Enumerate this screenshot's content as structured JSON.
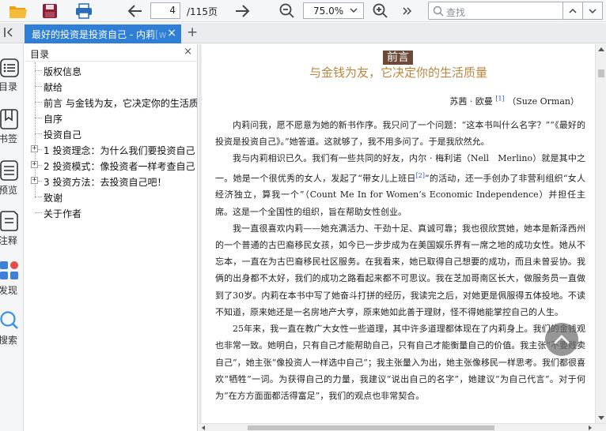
{
  "toolbar": {
    "page_current": "4",
    "page_total": "/115页",
    "zoom_value": "75.0%",
    "search_placeholder": "查找"
  },
  "tab": {
    "title_visible": "最好的投资是投资自己 - 内莉",
    "title_faded": "[w",
    "close_glyph": "×",
    "add_glyph": "+"
  },
  "rail": {
    "items": [
      {
        "label": "目录",
        "icon": "list-icon"
      },
      {
        "label": "书签",
        "icon": "bookmark-icon"
      },
      {
        "label": "预览",
        "icon": "thumbnails-icon"
      },
      {
        "label": "注释",
        "icon": "note-icon"
      },
      {
        "label": "发现",
        "icon": "discover-icon"
      },
      {
        "label": "搜索",
        "icon": "search-icon"
      }
    ]
  },
  "outline": {
    "title": "目录",
    "close_glyph": "×",
    "items": [
      {
        "label": "版权信息",
        "expandable": false
      },
      {
        "label": "献给",
        "expandable": false
      },
      {
        "label": "前言 与金钱为友，它决定你的生活质",
        "expandable": false
      },
      {
        "label": "自序",
        "expandable": false
      },
      {
        "label": "投资自己",
        "expandable": false
      },
      {
        "label": "1 投资理念：为什么我们要投资自己",
        "expandable": true
      },
      {
        "label": "2 投资模式：像投资者一样考查自己",
        "expandable": true
      },
      {
        "label": "3 投资方法：去投资自己吧！",
        "expandable": true
      },
      {
        "label": "致谢",
        "expandable": false
      },
      {
        "label": "关于作者",
        "expandable": false
      }
    ]
  },
  "document": {
    "heading": "前言",
    "subtitle": "与金钱为友，它决定你的生活质量",
    "author_name": "苏茜 · 欧曼",
    "author_note": "[1]",
    "author_english": "（Suze Orman）",
    "paragraphs": [
      {
        "text": "内莉问我，愿不愿意为她的新书作序。我只问了一个问题：“这本书叫什么名字？”“《最好的投资是投资自己》。”她答道。这就够了，我不用多问了。于是我欣然允。",
        "note": ""
      },
      {
        "text": "我与内莉相识已久。我们有一些共同的好友，内尔 · 梅利诺（Nell　Merlino）就是其中之一。她是一个很优秀的女人，发起了“带女儿上班日",
        "note": "[2]",
        "text_after": "”的活动，还一手创办了非营利组织“女人经济独立，算我一个”（Count Me In for Women’s Economic Independence）并担任主席。这是一个全国性的组织，旨在帮助女性创业。"
      },
      {
        "text": "我一直很喜欢内莉——她充满活力、干劲十足、真诚可靠；我也很欣赏她，她本是新泽西州的一个普通的古巴裔移民女孩，如今已一步步成为在美国娱乐界有一席之地的成功女性。她从不忘本，一直在为古巴裔移民社区服务。在我看来，她已取得自己想要的成功，而且未曾妥协。我俩的出身都不太好，我们的成功之路看起来都不可思议。我在芝加哥南区长大，做服务员一直做到了30岁。内莉在本书中写了她奋斗打拼的经历，我读完之后，对她更是佩服得五体投地。不读不知道，原来她还是一名房地产大亨，原来她如此善于理财，怪不得她能掌控自己的人生。",
        "note": ""
      },
      {
        "text": "25年来，我一直在教广大女性一些道理，其中许多道理都体现在了内莉身上。我们的金钱观也非常一致。她明白，只有自己才能帮助自己，只有自己才能衡量自己的价值。我主张“不要贱卖自己”，她主张“像投资人一样选中自己”；我主张量入为出，她主张像移民一样思考。我们都很喜欢“牺牲”一词。为获得自己的力量，我建议“说出自己的名字”，她建议“为自己代言”。对于何为“在方方面面都活得富足”，我们的观点也非常契合。",
        "note": ""
      }
    ]
  }
}
